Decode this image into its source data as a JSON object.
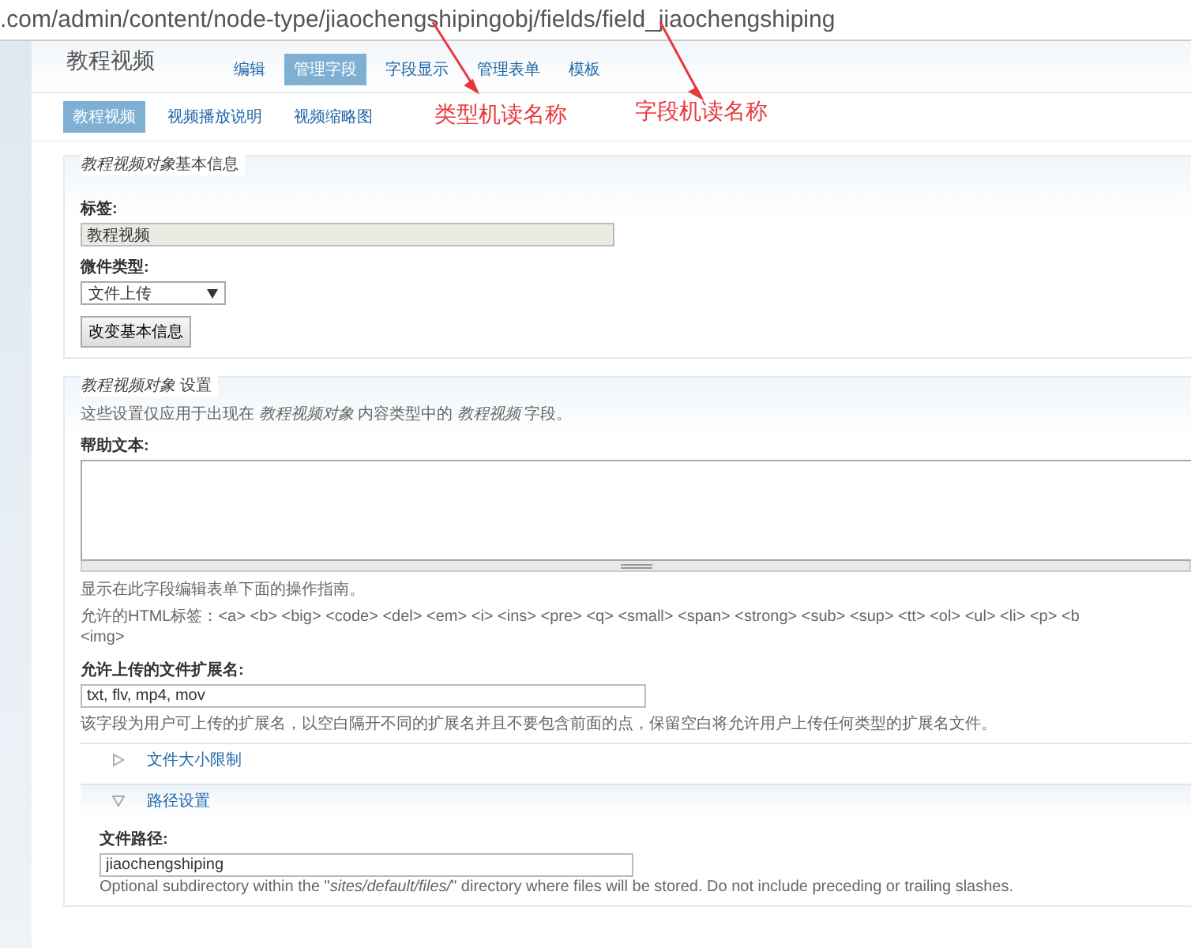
{
  "address_bar": {
    "url": ".com/admin/content/node-type/jiaochengshipingobj/fields/field_jiaochengshiping"
  },
  "page": {
    "title": "教程视频"
  },
  "tabs": [
    {
      "label": "编辑",
      "selected": false
    },
    {
      "label": "管理字段",
      "selected": true
    },
    {
      "label": "字段显示",
      "selected": false
    },
    {
      "label": "管理表单",
      "selected": false
    },
    {
      "label": "模板",
      "selected": false
    }
  ],
  "subtabs": [
    {
      "label": "教程视频",
      "selected": true
    },
    {
      "label": "视频播放说明",
      "selected": false
    },
    {
      "label": "视频缩略图",
      "selected": false
    }
  ],
  "annotations": [
    "类型机读名称",
    "字段机读名称"
  ],
  "basic_info": {
    "legend_italic": "教程视频对象",
    "legend": "基本信息",
    "label_title": "标签:",
    "label_value": "教程视频",
    "widget_title": "微件类型:",
    "widget_value": "文件上传",
    "button": "改变基本信息"
  },
  "settings": {
    "legend": "*教程视频对象* 设置",
    "intro": "这些设置仅应用于出现在 *教程视频对象* 内容类型中的 *教程视频* 字段。",
    "help_title": "帮助文本:",
    "help_desc": "显示在此字段编辑表单下面的操作指南。",
    "allowed_tags": [
      "允许的HTML标签：<a> <b> <big> <code> <del> <em> <i> <ins> <pre> <q> <small> <span> <strong> <sub> <sup> <tt> <ol> <ul> <li> <p> <b",
      "<img>"
    ],
    "ext_title": "允许上传的文件扩展名:",
    "ext_value": "txt, flv, mp4, mov",
    "ext_desc": "该字段为用户可上传的扩展名，以空白隔开不同的扩展名并且不要包含前面的点，保留空白将允许用户上传任何类型的扩展名文件。",
    "groups": [
      {
        "label": "文件大小限制",
        "expanded": false
      },
      {
        "label": "路径设置",
        "expanded": true
      }
    ],
    "path_title": "文件路径:",
    "path_value": "jiaochengshiping",
    "path_desc": "Optional subdirectory within the \"*sites/default/files/*\" directory where files will be stored. Do not include preceding or trailing slashes."
  }
}
